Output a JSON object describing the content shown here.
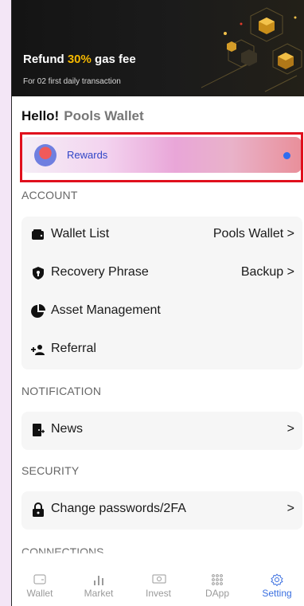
{
  "banner": {
    "title_prefix": "Refund ",
    "title_highlight": "30%",
    "title_suffix": " gas fee",
    "subtitle": "For 02 first daily transaction"
  },
  "greeting": {
    "hello": "Hello!",
    "wallet_name": "Pools Wallet"
  },
  "rewards": {
    "label": "Rewards"
  },
  "sections": {
    "account": "ACCOUNT",
    "notification": "NOTIFICATION",
    "security": "SECURITY",
    "connections": "CONNECTIONS"
  },
  "account": {
    "wallet_list": {
      "label": "Wallet List",
      "value": "Pools Wallet",
      "icon": "wallet-icon"
    },
    "recovery": {
      "label": "Recovery Phrase",
      "value": "Backup",
      "icon": "shield-icon"
    },
    "asset": {
      "label": "Asset Management",
      "icon": "pie-chart-icon"
    },
    "referral": {
      "label": "Referral",
      "icon": "add-users-icon"
    }
  },
  "notification": {
    "news": {
      "label": "News",
      "icon": "news-icon"
    }
  },
  "security": {
    "password": {
      "label": "Change passwords/2FA",
      "icon": "lock-icon"
    }
  },
  "chevron": ">",
  "nav": {
    "wallet": "Wallet",
    "market": "Market",
    "invest": "Invest",
    "dapp": "DApp",
    "setting": "Setting"
  },
  "colors": {
    "accent": "#3a6fe0",
    "highlight": "#f5b800",
    "frame": "#e0101d"
  }
}
